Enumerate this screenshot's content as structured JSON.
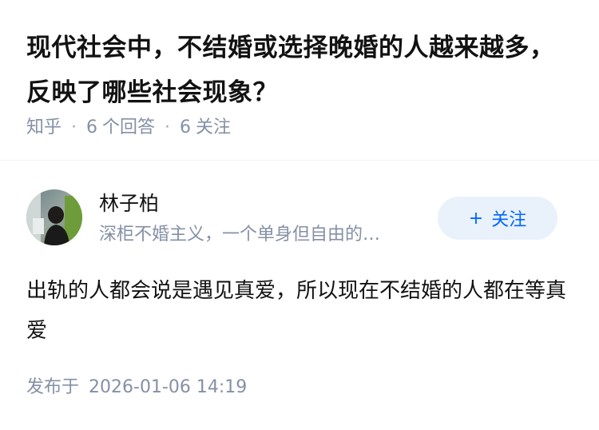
{
  "question": {
    "title": "现代社会中，不结婚或选择晚婚的人越来越多，反映了哪些社会现象？"
  },
  "meta": {
    "source": "知乎",
    "answer_count": "6",
    "answer_label": "个回答",
    "follow_count": "6",
    "follow_label": "关注"
  },
  "author": {
    "name": "林子柏",
    "bio": "深柜不婚主义，一个单身但自由的…",
    "follow_button": "关注",
    "follow_icon": "plus-icon"
  },
  "answer": {
    "content": "出轨的人都会说是遇见真爱，所以现在不结婚的人都在等真爱",
    "published_label": "发布于",
    "published_time": "2026-01-06 14:19"
  },
  "colors": {
    "accent": "#0066ff",
    "button_bg": "#e9f1fb",
    "muted_text": "#8590a6",
    "primary_text": "#121212"
  }
}
